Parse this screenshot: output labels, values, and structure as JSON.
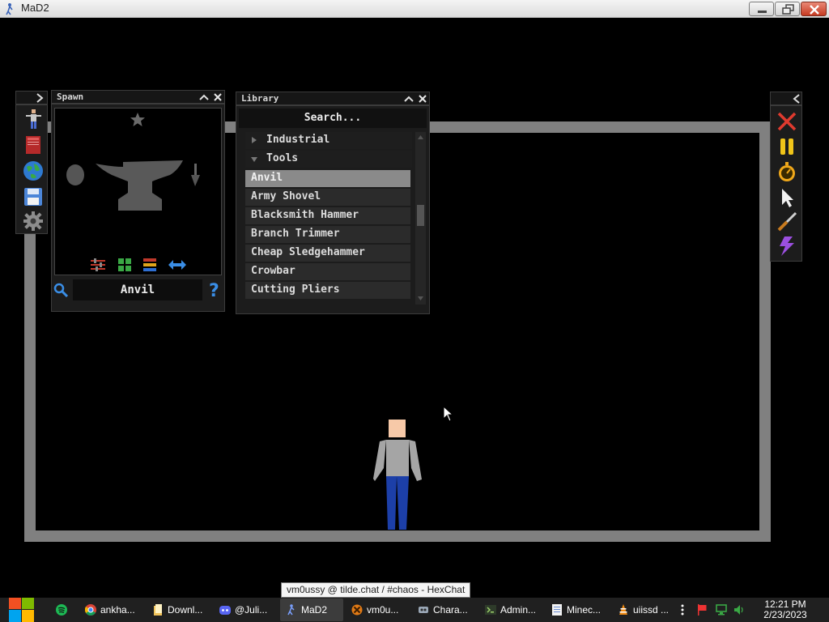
{
  "window": {
    "title": "MaD2",
    "minimize_icon": "minimize-icon",
    "maximize_icon": "restore-icon",
    "close_icon": "close-icon"
  },
  "left_toolbar": {
    "toggle_icon": "chevron-right-icon",
    "tools": [
      "ragdoll-icon",
      "book-icon",
      "globe-icon",
      "save-disk-icon",
      "gear-icon"
    ]
  },
  "spawn": {
    "title": "Spawn",
    "selected_name": "Anvil",
    "preview_items": [
      "egg-icon",
      "anvil-icon",
      "trowel-icon"
    ],
    "favorite_icon": "star-icon",
    "view_buttons": [
      "sliders-icon",
      "grid-icon",
      "list-icon",
      "swap-arrows-icon"
    ],
    "search_icon": "magnifier-icon",
    "help_icon": "question-icon"
  },
  "library": {
    "title": "Library",
    "search_placeholder": "Search...",
    "categories": [
      {
        "label": "Industrial",
        "expanded": false
      },
      {
        "label": "Tools",
        "expanded": true
      }
    ],
    "items": [
      "Anvil",
      "Army Shovel",
      "Blacksmith Hammer",
      "Branch Trimmer",
      "Cheap Sledgehammer",
      "Crowbar",
      "Cutting Pliers"
    ],
    "selected_item": "Anvil"
  },
  "right_toolbar": {
    "toggle_icon": "chevron-left-icon",
    "tools": [
      "clear-x-icon",
      "pause-icon",
      "stopwatch-icon",
      "pointer-icon",
      "knife-icon",
      "lightning-icon"
    ]
  },
  "tooltip": "vm0ussy @ tilde.chat / #chaos - HexChat",
  "taskbar": {
    "items": [
      {
        "label": "",
        "icon": "spotify-icon"
      },
      {
        "label": "ankha...",
        "icon": "chrome-icon"
      },
      {
        "label": "Downl...",
        "icon": "folder-icon"
      },
      {
        "label": "@Juli...",
        "icon": "discord-icon"
      },
      {
        "label": "MaD2",
        "icon": "mad2-icon",
        "active": true
      },
      {
        "label": "vm0u...",
        "icon": "hexchat-icon"
      },
      {
        "label": "Chara...",
        "icon": "app-icon"
      },
      {
        "label": "Admin...",
        "icon": "terminal-icon"
      },
      {
        "label": "Minec...",
        "icon": "notepad-icon"
      },
      {
        "label": "uiissd ...",
        "icon": "vlc-icon"
      }
    ],
    "tray": [
      "more-icon",
      "flag-icon",
      "network-icon",
      "volume-icon"
    ],
    "time": "12:21 PM",
    "date": "2/23/2023"
  },
  "colors": {
    "arena_border": "#808080",
    "selected_row": "#8a8a8a",
    "panel_bg": "#1c1c1c"
  }
}
